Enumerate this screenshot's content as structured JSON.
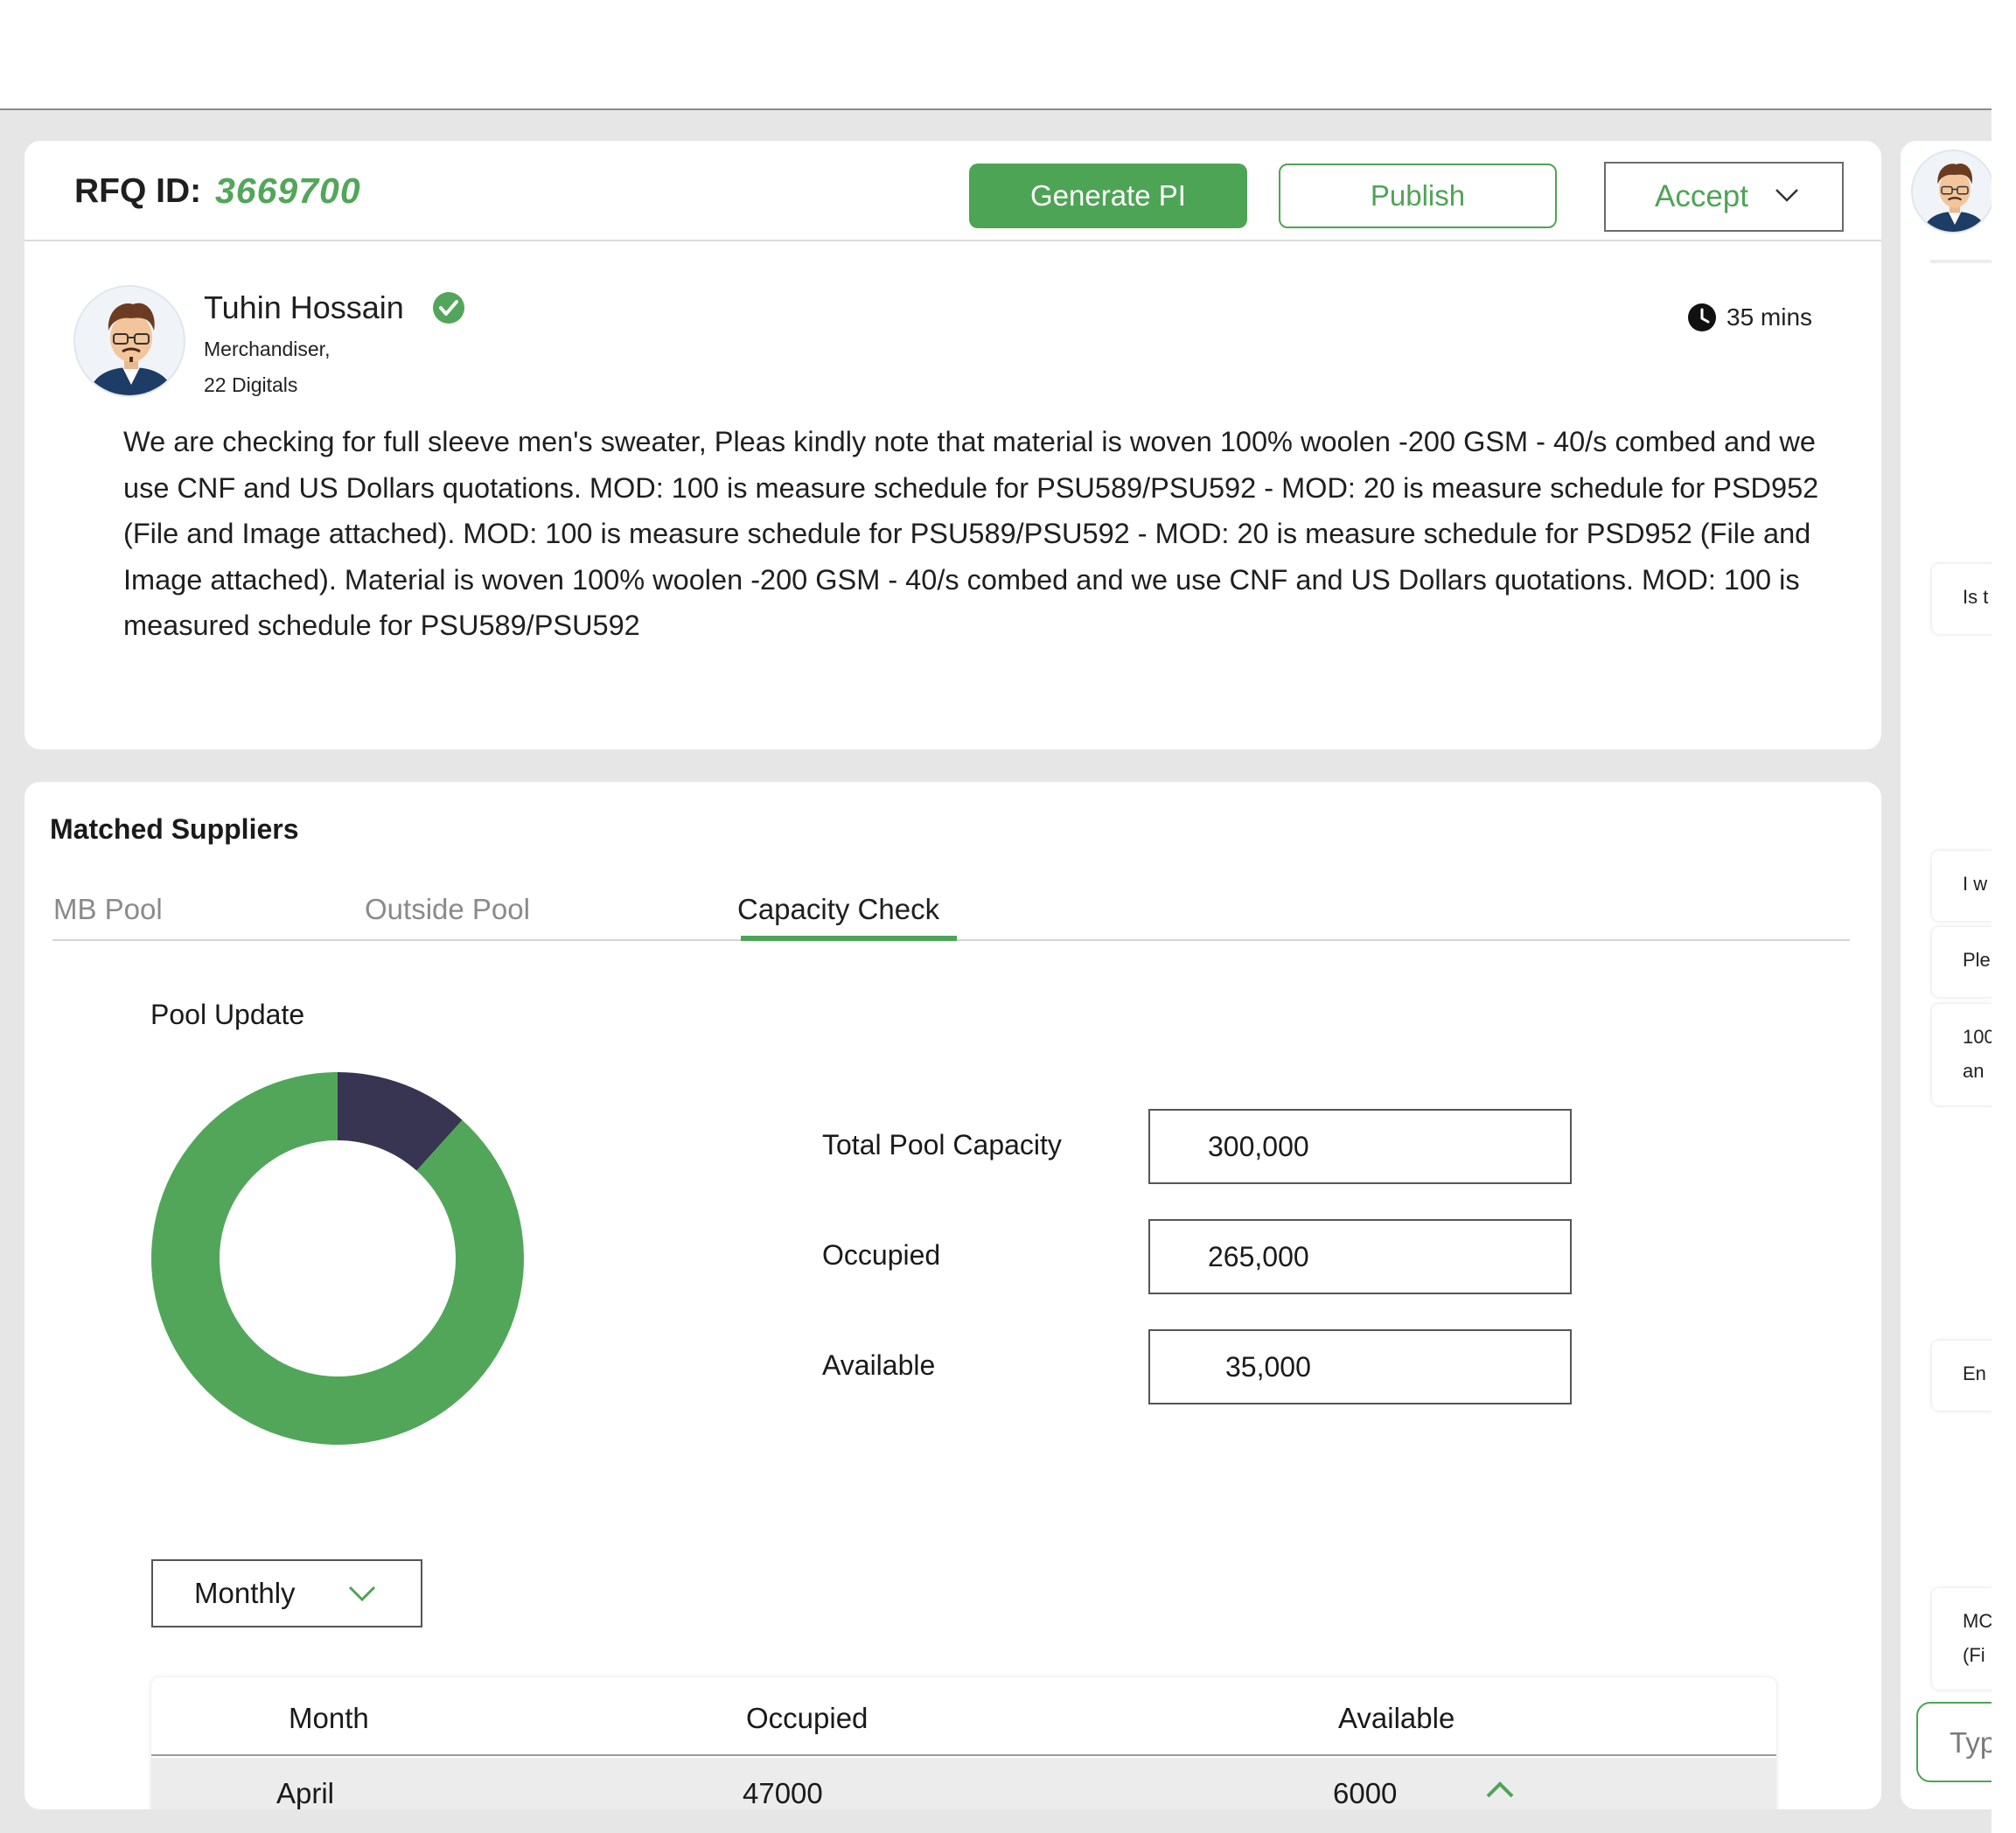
{
  "rfq": {
    "label": "RFQ ID:",
    "id": "3669700",
    "buttons": {
      "generate_pi": "Generate PI",
      "publish": "Publish",
      "accept": "Accept"
    }
  },
  "post": {
    "author": "Tuhin Hossain",
    "role": "Merchandiser,",
    "company": "22 Digitals",
    "time": "35 mins",
    "body": "We are checking for full sleeve men's  sweater, Pleas kindly note that material is woven 100% woolen -200 GSM - 40/s combed and we use CNF and US Dollars quotations. MOD: 100 is measure schedule for PSU589/PSU592 - MOD: 20 is measure schedule for PSD952 (File and Image attached). MOD: 100 is measure schedule for PSU589/PSU592 - MOD: 20 is measure schedule for PSD952 (File and Image attached). Material is woven 100% woolen -200 GSM - 40/s combed and we use CNF and US Dollars quotations. MOD: 100 is measured schedule for PSU589/PSU592"
  },
  "suppliers": {
    "title": "Matched Suppliers",
    "tabs": [
      "MB Pool",
      "Outside Pool",
      "Capacity Check"
    ],
    "active_tab": "Capacity Check",
    "pool": {
      "title": "Pool Update",
      "stats": [
        {
          "label": "Total Pool Capacity",
          "value": "300,000"
        },
        {
          "label": "Occupied",
          "value": "265,000"
        },
        {
          "label": "Available",
          "value": "35,000"
        }
      ]
    },
    "period_select": "Monthly",
    "table": {
      "headers": [
        "Month",
        "Occupied",
        "Available"
      ],
      "rows": [
        {
          "month": "April",
          "occupied": "47000",
          "available": "6000"
        }
      ]
    }
  },
  "chart_data": {
    "type": "pie",
    "donut": true,
    "slices": [
      {
        "label": "Available",
        "value": 35000,
        "color": "#373552"
      },
      {
        "label": "Occupied",
        "value": 265000,
        "color": "#52a65a"
      }
    ]
  },
  "side_panel": {
    "chips": [
      "Is t",
      "I w",
      "Ple",
      "100\nan",
      "En",
      "MC\n(Fi"
    ],
    "input_placeholder": "Typ"
  },
  "colors": {
    "accent": "#4ea455",
    "dark_slice": "#373552",
    "background": "#e6e6e6"
  }
}
